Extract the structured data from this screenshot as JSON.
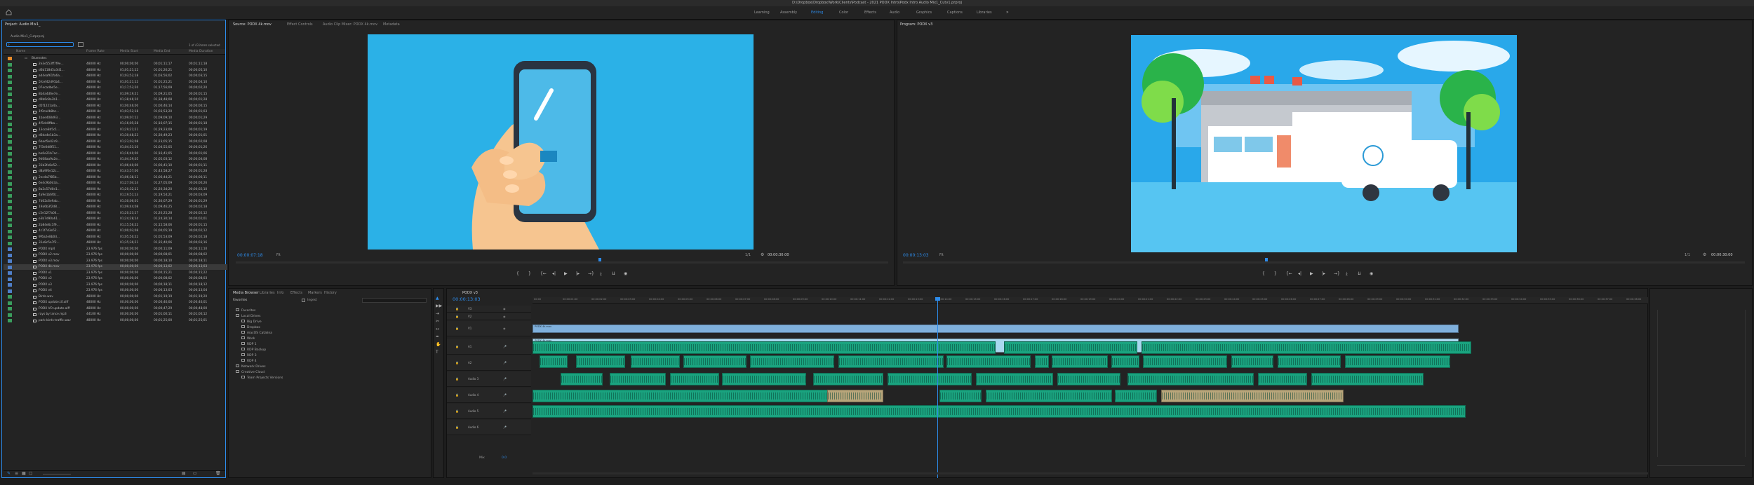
{
  "window": {
    "title": "D:\\Dropbox\\Dropbox\\Work\\Clients\\Podcast - 2021 PODX Intro\\Podx Intro Audio Mix1_Cutv1.prproj"
  },
  "workspaces": [
    "Learning",
    "Assembly",
    "Editing",
    "Color",
    "Effects",
    "Audio",
    "Graphics",
    "Captions",
    "Libraries"
  ],
  "active_workspace": "Editing",
  "project": {
    "title": "Project: Audio Mix1_",
    "name": "Audio Mix1_Cutprproj",
    "items_selected": "1 of 43 items selected",
    "columns": [
      "Name",
      "Frame Rate",
      "Media Start",
      "Media End",
      "Media Duration"
    ],
    "bin_label": "Bluenotes",
    "items": [
      {
        "name": "2e3e553ff7f9e...",
        "rate": "48000 Hz",
        "start": "00;00;00;00",
        "end": "00;01;11;17",
        "dur": "00;01;11;18",
        "color": "#3a9e5d"
      },
      {
        "name": "d6b118d5a3d1...",
        "rate": "48000 Hz",
        "start": "01;01;21;12",
        "end": "01;01;26;21",
        "dur": "00;00;05;10",
        "color": "#3a9e5d"
      },
      {
        "name": "ad4eaf61fa6a...",
        "rate": "48000 Hz",
        "start": "01;03;52;18",
        "end": "01;03;56;02",
        "dur": "00;00;03;15",
        "color": "#3a9e5d"
      },
      {
        "name": "5fcef42d91b4...",
        "rate": "48000 Hz",
        "start": "01;01;21;12",
        "end": "01;01;25;21",
        "dur": "00;00;04;10",
        "color": "#3a9e5d"
      },
      {
        "name": "07ecadbe5e...",
        "rate": "48000 Hz",
        "start": "01;17;53;20",
        "end": "01;17;56;09",
        "dur": "00;00;02;20",
        "color": "#3a9e5d"
      },
      {
        "name": "8b4a4d6e7e...",
        "rate": "48000 Hz",
        "start": "01;09;19;21",
        "end": "01;09;21;05",
        "dur": "00;00;01;15",
        "color": "#3a9e5d"
      },
      {
        "name": "d9b6c8a3b1...",
        "rate": "48000 Hz",
        "start": "01;38;46;10",
        "end": "01;38;48;08",
        "dur": "00;00;01;28",
        "color": "#3a9e5d"
      },
      {
        "name": "d5f1221a4a...",
        "rate": "48000 Hz",
        "start": "01;00;46;00",
        "end": "01;00;46;14",
        "dur": "00;00;00;15",
        "color": "#3a9e5d"
      },
      {
        "name": "1f0ca4b8bc...",
        "rate": "48000 Hz",
        "start": "01;03;52;18",
        "end": "01;03;53;20",
        "dur": "00;00;01;03",
        "color": "#3a9e5d"
      },
      {
        "name": "1bae408d93...",
        "rate": "48000 Hz",
        "start": "01;09;07;12",
        "end": "01;09;09;10",
        "dur": "00;00;01;29",
        "color": "#3a9e5d"
      },
      {
        "name": "4f5dc8ffba...",
        "rate": "48000 Hz",
        "start": "01;16;05;28",
        "end": "01;16;07;15",
        "dur": "00;00;01;18",
        "color": "#3a9e5d"
      },
      {
        "name": "13cce8d5c1...",
        "rate": "48000 Hz",
        "start": "01;29;21;21",
        "end": "01;29;23;09",
        "dur": "00;00;01;19",
        "color": "#3a9e5d"
      },
      {
        "name": "d6da4e1b3a...",
        "rate": "48000 Hz",
        "start": "01;30;48;23",
        "end": "01;30;49;23",
        "dur": "00;00;01;01",
        "color": "#3a9e5d"
      },
      {
        "name": "6bad5e42c9...",
        "rate": "48000 Hz",
        "start": "01;23;03;08",
        "end": "01;23;05;15",
        "dur": "00;00;02;08",
        "color": "#3a9e5d"
      },
      {
        "name": "7f3e0d8f51...",
        "rate": "48000 Hz",
        "start": "01;04;53;10",
        "end": "01;04;55;05",
        "dur": "00;00;01;26",
        "color": "#3a9e5d"
      },
      {
        "name": "be0e21b7ac...",
        "rate": "48000 Hz",
        "start": "01;16;40;00",
        "end": "01;16;41;05",
        "dur": "00;00;01;06",
        "color": "#3a9e5d"
      },
      {
        "name": "9d08aa9a2e...",
        "rate": "48000 Hz",
        "start": "01;04;59;05",
        "end": "01;05;03;12",
        "dur": "00;00;04;08",
        "color": "#3a9e5d"
      },
      {
        "name": "31b2fe8e52...",
        "rate": "48000 Hz",
        "start": "01;06;40;00",
        "end": "01;06;41;10",
        "dur": "00;00;01;11",
        "color": "#3a9e5d"
      },
      {
        "name": "d8a9f0e12c...",
        "rate": "48000 Hz",
        "start": "01;43;57;00",
        "end": "01;43;58;27",
        "dur": "00;00;01;28",
        "color": "#3a9e5d"
      },
      {
        "name": "2ec4a7f85b...",
        "rate": "48000 Hz",
        "start": "01;06;38;11",
        "end": "01;06;44;21",
        "dur": "00;00;06;11",
        "color": "#3a9e5d"
      },
      {
        "name": "6e4c9b0d3a...",
        "rate": "48000 Hz",
        "start": "01;27;04;14",
        "end": "01;27;05;09",
        "dur": "00;00;00;26",
        "color": "#3a9e5d"
      },
      {
        "name": "8a2c57d0e1...",
        "rate": "48000 Hz",
        "start": "01;20;32;11",
        "end": "01;20;34;20",
        "dur": "00;00;02;10",
        "color": "#3a9e5d"
      },
      {
        "name": "4a9e1b6f0c...",
        "rate": "48000 Hz",
        "start": "01;19;51;13",
        "end": "01;19;54;21",
        "dur": "00;00;03;09",
        "color": "#3a9e5d"
      },
      {
        "name": "7d02c6e9ab...",
        "rate": "48000 Hz",
        "start": "01;30;06;01",
        "end": "01;30;07;29",
        "dur": "00;00;01;29",
        "color": "#3a9e5d"
      },
      {
        "name": "19a6b3f2d8...",
        "rate": "48000 Hz",
        "start": "01;09;44;08",
        "end": "01;09;46;25",
        "dur": "00;00;02;18",
        "color": "#3a9e5d"
      },
      {
        "name": "c5e12f7a04...",
        "rate": "48000 Hz",
        "start": "01;20;23;17",
        "end": "01;20;25;28",
        "dur": "00;00;02;12",
        "color": "#3a9e5d"
      },
      {
        "name": "e3b7d90a61...",
        "rate": "48000 Hz",
        "start": "01;24;28;14",
        "end": "01;24;30;14",
        "dur": "00;00;02;01",
        "color": "#3a9e5d"
      },
      {
        "name": "2b84e6c1f9...",
        "rate": "48000 Hz",
        "start": "01;15;56;22",
        "end": "01;15;58;06",
        "dur": "00;00;01;15",
        "color": "#3a9e5d"
      },
      {
        "name": "4c1f7d3e52...",
        "rate": "48000 Hz",
        "start": "01;00;03;08",
        "end": "01;00;05;19",
        "dur": "00;00;02;12",
        "color": "#3a9e5d"
      },
      {
        "name": "9f6a2e8b0d...",
        "rate": "48000 Hz",
        "start": "01;05;50;22",
        "end": "01;05;53;09",
        "dur": "00;00;02;18",
        "color": "#3a9e5d"
      },
      {
        "name": "31e8c5a7f2...",
        "rate": "48000 Hz",
        "start": "01;35;36;21",
        "end": "01;35;40;06",
        "dur": "00;00;03;16",
        "color": "#3a9e5d"
      },
      {
        "name": "PODX mp4",
        "rate": "23.976 fps",
        "start": "00;00;00;00",
        "end": "00;00;11;09",
        "dur": "00;00;11;10",
        "color": "#4f7fc9"
      },
      {
        "name": "PODX v2.mov",
        "rate": "23.976 fps",
        "start": "00;00;00;00",
        "end": "00;00;08;01",
        "dur": "00;00;08;02",
        "color": "#4f7fc9"
      },
      {
        "name": "PODX v3.mov",
        "rate": "23.976 fps",
        "start": "00;00;00;00",
        "end": "00;00;18;10",
        "dur": "00;00;18;11",
        "color": "#4f7fc9"
      },
      {
        "name": "PODX 4k.mov",
        "rate": "23.976 fps",
        "start": "00;00;00;00",
        "end": "00;00;13;02",
        "dur": "00;00;13;03",
        "color": "#4f7fc9",
        "selected": true
      },
      {
        "name": "PODX v1",
        "rate": "23.976 fps",
        "start": "00;00;00;00",
        "end": "00;00;15;21",
        "dur": "00;00;15;22",
        "color": "#4f7fc9"
      },
      {
        "name": "PODX v2",
        "rate": "23.976 fps",
        "start": "00;00;00;00",
        "end": "00;00;08;02",
        "dur": "00;00;08;03",
        "color": "#4f7fc9"
      },
      {
        "name": "PODX v3",
        "rate": "23.976 fps",
        "start": "00;00;00;00",
        "end": "00;00;18;11",
        "dur": "00;00;18;12",
        "color": "#4f7fc9"
      },
      {
        "name": "PODX v4",
        "rate": "23.976 fps",
        "start": "00;00;00;00",
        "end": "00;00;13;03",
        "dur": "00;00;13;04",
        "color": "#4f7fc9"
      },
      {
        "name": "Birds.wav",
        "rate": "48000 Hz",
        "start": "00;00;00;00",
        "end": "00;01;19;19",
        "dur": "00;01;19;20",
        "color": "#3a9e5d"
      },
      {
        "name": "PODX update.tif.aiff",
        "rate": "48000 Hz",
        "start": "00;00;00;00",
        "end": "00;00;46;00",
        "dur": "00;00;46;01",
        "color": "#3a9e5d"
      },
      {
        "name": "PODX VO update.aiff",
        "rate": "48000 Hz",
        "start": "00;00;00;00",
        "end": "00;00;47;29",
        "dur": "00;00;48;00",
        "color": "#3a9e5d"
      },
      {
        "name": "rays by lance.mp3",
        "rate": "44100 Hz",
        "start": "00;00;00;00",
        "end": "00;01;00;11",
        "dur": "00;01;00;12",
        "color": "#3a9e5d"
      },
      {
        "name": "park-birds-traffic.wav",
        "rate": "48000 Hz",
        "start": "00;00;00;00",
        "end": "00;01;25;00",
        "dur": "00;01;25;01",
        "color": "#3a9e5d"
      }
    ]
  },
  "source": {
    "tabs": [
      "Source: PODX 4k.mov",
      "Effect Controls",
      "Audio Clip Mixer: PODX 4k.mov",
      "Metadata"
    ],
    "timecode": "00:00:07:18",
    "fit": "Fit",
    "ratio": "1/1",
    "duration": "00:00:30:00"
  },
  "program": {
    "title": "Program: PODX v3",
    "timecode": "00:00:13:03",
    "fit": "Fit",
    "ratio": "1/1",
    "duration": "00:00:30:00"
  },
  "media_browser": {
    "tabs": [
      "Media Browser",
      "Libraries",
      "Info",
      "Effects",
      "Markers",
      "History"
    ],
    "favorites": "Favorites",
    "ingest": "Ingest",
    "tree": [
      "Favorites",
      "Local Drives",
      "Big Drive",
      "Dropbox",
      "macOS Catalina",
      "Work",
      "RDP 1",
      "RDP Backup",
      "RDP 3",
      "RDP 4",
      "Network Drives",
      "Creative Cloud",
      "Team Projects Versions"
    ]
  },
  "timeline": {
    "title": "PODX v3",
    "timecode": "00:00:13:03",
    "ruler": [
      "00:00",
      "00:00:01:00",
      "00:00:02:00",
      "00:00:03:00",
      "00:00:04:00",
      "00:00:05:00",
      "00:00:06:00",
      "00:00:07:00",
      "00:00:08:00",
      "00:00:09:00",
      "00:00:10:00",
      "00:00:11:00",
      "00:00:12:00",
      "00:00:13:00",
      "00:00:14:00",
      "00:00:15:00",
      "00:00:16:00",
      "00:00:17:00",
      "00:00:18:00",
      "00:00:19:00",
      "00:00:20:00",
      "00:00:21:00",
      "00:00:22:00",
      "00:00:23:00",
      "00:00:24:00",
      "00:00:25:00",
      "00:00:26:00",
      "00:00:27:00",
      "00:00:28:00",
      "00:00:29:00",
      "00:00:30:00",
      "00:00:31:00",
      "00:00:32:00",
      "00:00:33:00",
      "00:00:34:00",
      "00:00:35:00",
      "00:00:36:00",
      "00:00:37:00",
      "00:00:38:00"
    ],
    "video_tracks": [
      "V3",
      "V2",
      "V1"
    ],
    "audio_tracks": [
      "A1",
      "A2",
      "Audio 3",
      "Audio 4",
      "Audio 5",
      "Audio 6"
    ],
    "clip_v2": "PODX 4k.mov",
    "clip_v1": "PODX 4k.mov",
    "mix": "Mix",
    "mix_value": "0.0"
  },
  "colors": {
    "accent": "#2d8ceb",
    "video_clip": "#7fb0dc",
    "audio_clip": "#1aa37f"
  }
}
